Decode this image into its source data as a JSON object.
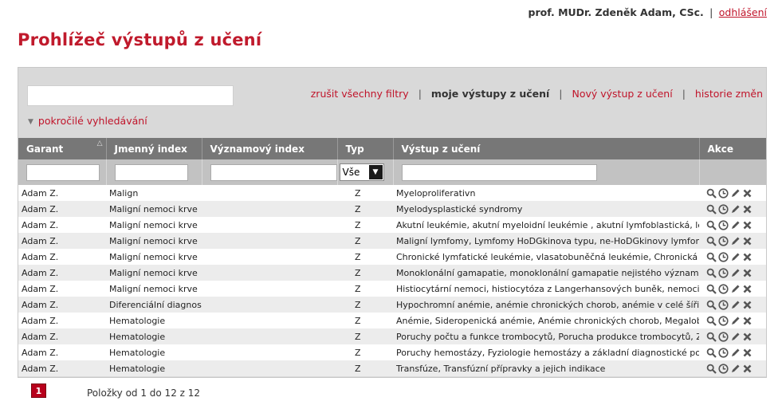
{
  "user": {
    "name": "prof. MUDr. Zdeněk Adam, CSc.",
    "separator": "|",
    "logout": "odhlášení"
  },
  "page_title": "Prohlížeč výstupů z učení",
  "toolbar": {
    "clear_filters": "zrušit všechny filtry",
    "my_outputs": "moje výstupy z učení",
    "new_output": "Nový výstup z učení",
    "history": "historie změn",
    "separator": "|",
    "advanced_search": "pokročilé vyhledávání"
  },
  "table": {
    "headers": [
      "Garant",
      "Jmenný index",
      "Významový index",
      "Typ",
      "Výstup z učení",
      "Akce"
    ],
    "type_filter_value": "Vše",
    "rows": [
      [
        "Adam Z.",
        "Malign",
        "",
        "Z",
        "Myeloproliferativn"
      ],
      [
        "Adam Z.",
        "Maligní nemoci krve",
        "",
        "Z",
        "Myelodysplastické syndromy"
      ],
      [
        "Adam Z.",
        "Maligní nemoci krve",
        "",
        "Z",
        "Akutní leukémie, akutní myeloidní leukémie , akutní lymfoblastická, leukémie"
      ],
      [
        "Adam Z.",
        "Maligní nemoci krve",
        "",
        "Z",
        "Maligní lymfomy, Lymfomy HoDGkinova typu, ne-HoDGkinovy lymfomy"
      ],
      [
        "Adam Z.",
        "Maligní nemoci krve",
        "",
        "Z",
        "Chronické lymfatické leukémie, vlasatobuněčná leukémie, Chronická B-lymfocytá"
      ],
      [
        "Adam Z.",
        "Maligní nemoci krve",
        "",
        "Z",
        "Monoklonální gamapatie, monoklonální gamapatie nejistého významu (MGUS), m"
      ],
      [
        "Adam Z.",
        "Maligní nemoci krve",
        "",
        "Z",
        "Histiocytární nemoci, histiocytóza z Langerhansových buněk, nemoci ze skupiny"
      ],
      [
        "Adam Z.",
        "Diferenciální diagnostiky",
        "",
        "Z",
        "Hypochromní anémie, anémie chronických chorob, anémie v celé šíři, trombocyt"
      ],
      [
        "Adam Z.",
        "Hematologie",
        "",
        "Z",
        "Anémie, Sideropenická anémie, Anémie chronických chorob, Megaloblastové an"
      ],
      [
        "Adam Z.",
        "Hematologie",
        "",
        "Z",
        "Poruchy počtu a funkce trombocytů, Porucha produkce trombocytů, Zvýšená d"
      ],
      [
        "Adam Z.",
        "Hematologie",
        "",
        "Z",
        "Poruchy hemostázy, Fyziologie hemostázy a základní diagnostické postupy, Vro"
      ],
      [
        "Adam Z.",
        "Hematologie",
        "",
        "Z",
        "Transfúze, Transfúzní přípravky a jejich indikace"
      ]
    ],
    "action_icons": [
      "search-icon",
      "history-clock-icon",
      "edit-pencil-icon",
      "delete-x-icon"
    ]
  },
  "pagination": {
    "current_page": "1",
    "info": "Položky od 1 do 12 z 12"
  },
  "colors": {
    "accent": "#c0142a",
    "header_bg": "#777777",
    "filter_bg": "#c2c2c2",
    "panel_bg": "#d9d9d9"
  }
}
